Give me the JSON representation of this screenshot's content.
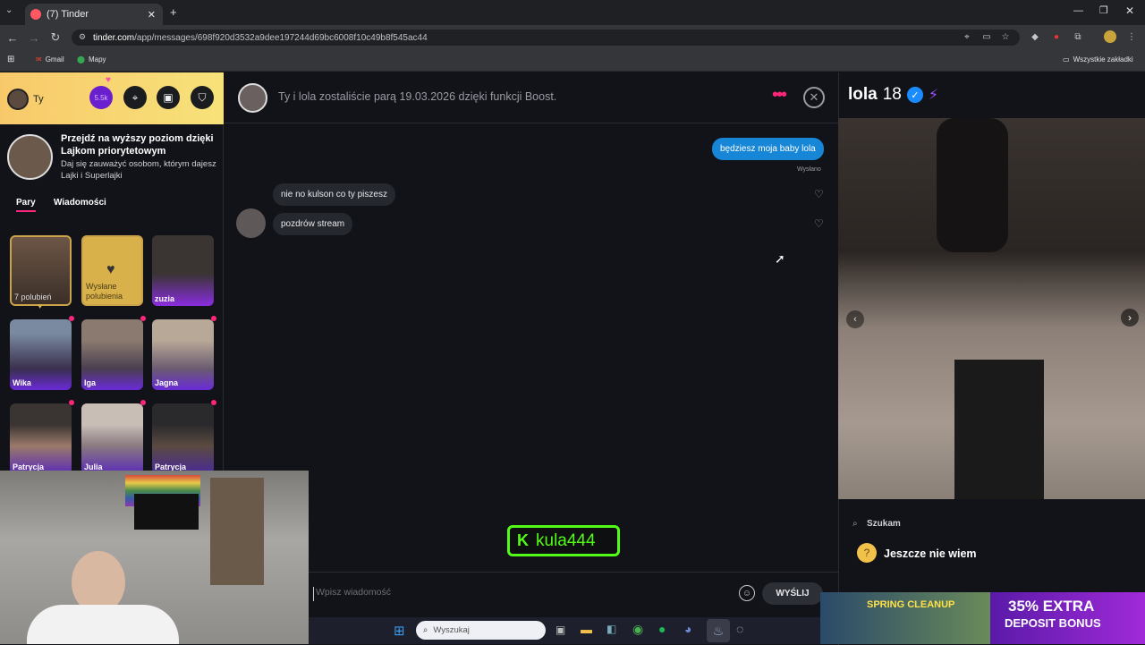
{
  "browser": {
    "tab_title": "(7) Tinder",
    "url_host": "tinder.com",
    "url_path": "/app/messages/698f920d3532a9dee197244d69bc6008f10c49b8f545ac44",
    "bookmarks": [
      "Gmail",
      "Mapy"
    ],
    "all_bookmarks": "Wszystkie zakładki"
  },
  "sidebar": {
    "user_label": "Ty",
    "badge_count": "5.5k",
    "promo_title": "Przejdź na wyższy poziom dzięki Lajkom priorytetowym",
    "promo_text": "Daj się zauważyć osobom, którym dajesz Lajki i Superlajki",
    "tabs": [
      "Pary",
      "Wiadomości"
    ],
    "likes_card": "7 polubień",
    "sent_card": "Wysłane polubienia",
    "matches": [
      "zuzia",
      "Wika",
      "Iga",
      "Jagna",
      "Patrycja",
      "Julia",
      "Patrycja"
    ]
  },
  "chat": {
    "match_info": "Ty i lola zostaliście parą 19.03.2026 dzięki funkcji Boost.",
    "messages": [
      {
        "text": "będziesz moja baby lola",
        "from": "me",
        "status": "Wysłano"
      },
      {
        "text": "nie no kulson co ty piszesz",
        "from": "them"
      },
      {
        "text": "pozdrów stream",
        "from": "them"
      }
    ],
    "input_placeholder": "Wpisz wiadomość",
    "send_label": "WYŚLIJ",
    "overlay_tag": "kula444"
  },
  "profile": {
    "name": "lola",
    "age": "18",
    "looking_label": "Szukam",
    "looking_value": "Jeszcze nie wiem"
  },
  "ad": {
    "line1": "SPRING CLEANUP",
    "line2": "35% EXTRA",
    "line3": "DEPOSIT BONUS"
  },
  "taskbar": {
    "search_placeholder": "Wyszukaj"
  },
  "colors": {
    "accent": "#fd267a",
    "send_bubble": "#1786d6",
    "gold": "#f8c96a",
    "kick_green": "#53fc18"
  }
}
